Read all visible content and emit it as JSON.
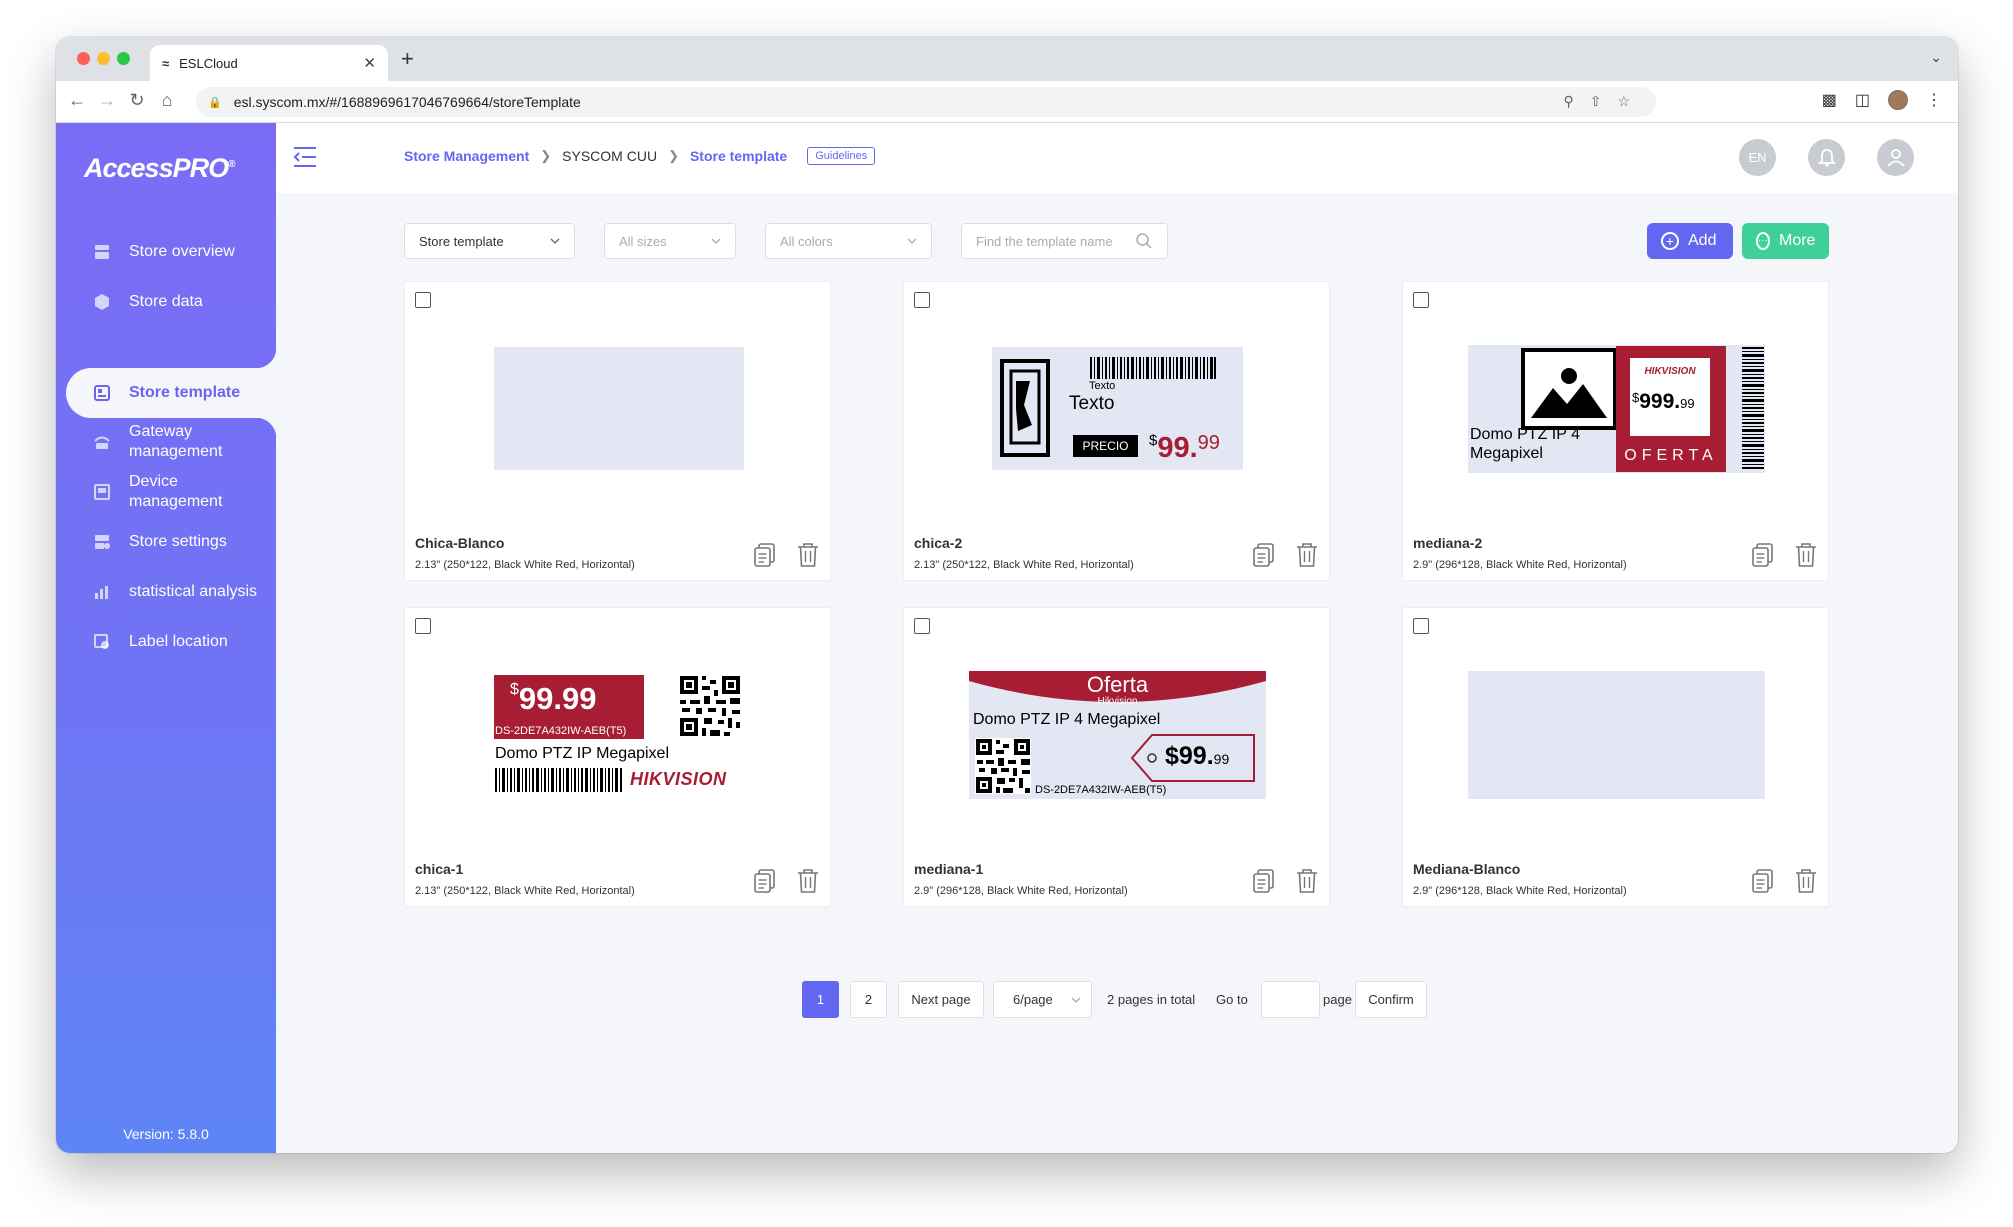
{
  "browser": {
    "tab_title": "ESLCloud",
    "url": "esl.syscom.mx/#/1688969617046769664/storeTemplate"
  },
  "sidebar": {
    "logo": "AccessPRO",
    "logo_mark": "®",
    "items": [
      {
        "label": "Store overview",
        "icon": "store-icon"
      },
      {
        "label": "Store data",
        "icon": "cube-icon"
      },
      {
        "label": "Store template",
        "icon": "template-icon",
        "active": true
      },
      {
        "label": "Gateway management",
        "icon": "gateway-icon"
      },
      {
        "label": "Device management",
        "icon": "device-icon"
      },
      {
        "label": "Store settings",
        "icon": "settings-icon"
      },
      {
        "label": "statistical analysis",
        "icon": "chart-icon"
      },
      {
        "label": "Label location",
        "icon": "location-icon"
      }
    ],
    "version": "Version: 5.8.0"
  },
  "header": {
    "breadcrumb": [
      "Store Management",
      "SYSCOM CUU",
      "Store template"
    ],
    "guidelines": "Guidelines",
    "lang": "EN"
  },
  "filters": {
    "type": "Store template",
    "sizes_placeholder": "All sizes",
    "colors_placeholder": "All colors",
    "search_placeholder": "Find the template name"
  },
  "actions": {
    "add": "Add",
    "more": "More"
  },
  "cards": [
    {
      "name": "Chica-Blanco",
      "desc": "2.13\" (250*122, Black White Red, Horizontal)"
    },
    {
      "name": "chica-2",
      "desc": "2.13\" (250*122, Black White Red, Horizontal)"
    },
    {
      "name": "mediana-2",
      "desc": "2.9\" (296*128, Black White Red, Horizontal)"
    },
    {
      "name": "chica-1",
      "desc": "2.13\" (250*122, Black White Red, Horizontal)"
    },
    {
      "name": "mediana-1",
      "desc": "2.9\" (296*128, Black White Red, Horizontal)"
    },
    {
      "name": "Mediana-Blanco",
      "desc": "2.9\" (296*128, Black White Red, Horizontal)"
    }
  ],
  "previews": {
    "chica2": {
      "text_small": "Texto",
      "text_big": "Texto",
      "precio": "PRECIO",
      "currency": "$",
      "price_int": "99.",
      "price_dec": "99"
    },
    "mediana2": {
      "title": "Domo PTZ IP 4 Megapixel",
      "brand": "HIKVISION",
      "currency": "$",
      "price_int": "999.",
      "price_dec": "99",
      "oferta": "OFERTA"
    },
    "chica1": {
      "currency": "$",
      "price": "99.99",
      "model": "DS-2DE7A432IW-AEB(T5)",
      "title": "Domo PTZ IP Megapixel",
      "brand": "HIKVISION"
    },
    "mediana1": {
      "oferta": "Oferta",
      "brand": "Hikvision",
      "title": "Domo PTZ IP 4 Megapixel",
      "price_int": "$99.",
      "price_dec": "99",
      "model": "DS-2DE7A432IW-AEB(T5)"
    }
  },
  "pagination": {
    "pages": [
      "1",
      "2"
    ],
    "current": "1",
    "next": "Next page",
    "page_size": "6/page",
    "total": "2 pages in total",
    "goto": "Go to",
    "page": "page",
    "confirm": "Confirm"
  },
  "colors": {
    "accent": "#6366f1",
    "more": "#3ecf9a",
    "label_red": "#a71e34"
  }
}
